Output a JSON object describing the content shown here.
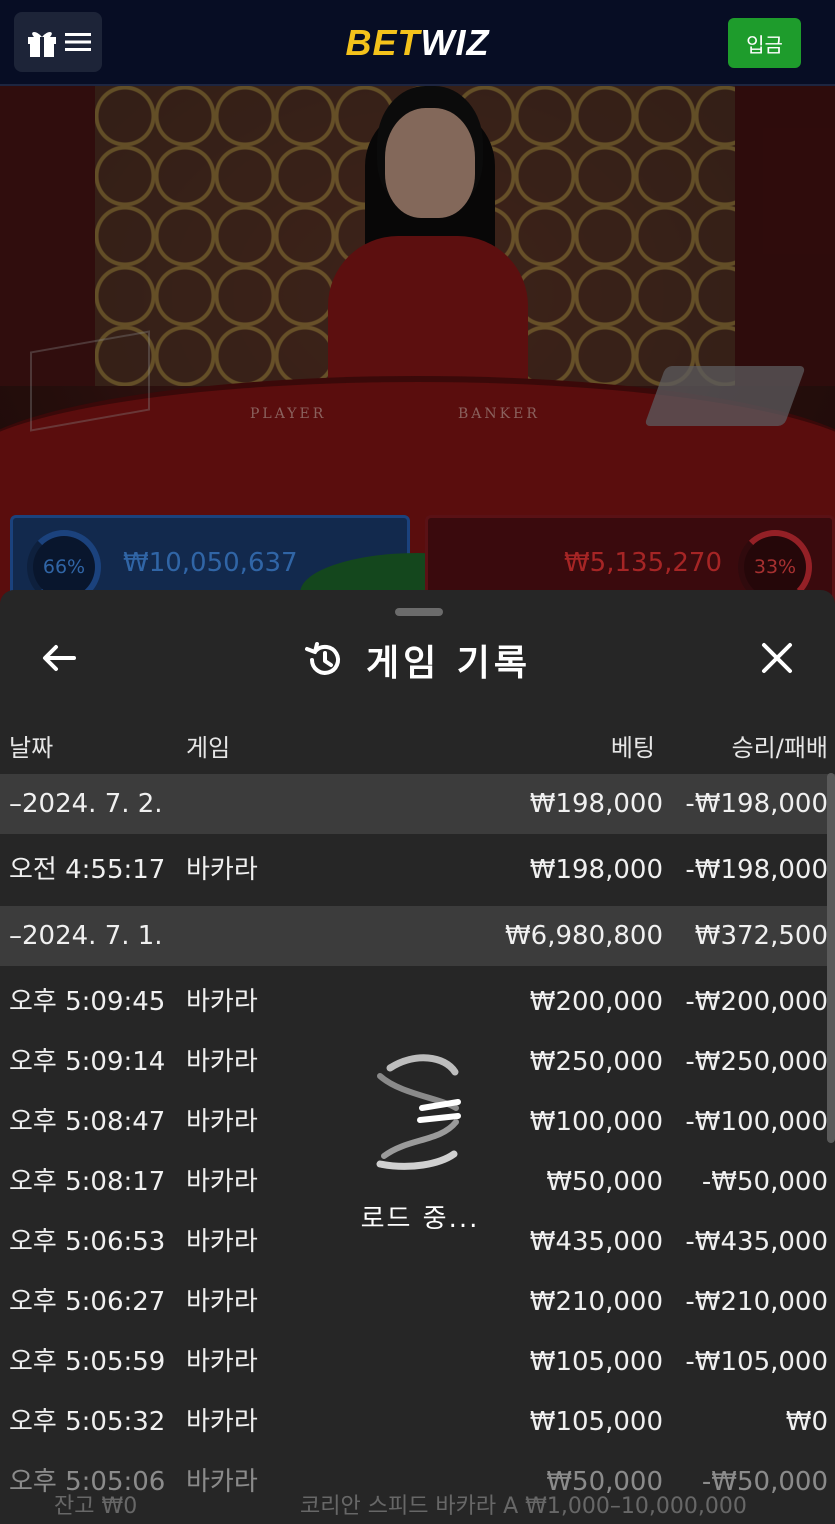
{
  "header": {
    "logo_bet": "BET",
    "logo_wiz": "WIZ",
    "deposit_label": "입금"
  },
  "table": {
    "player_label": "PLAYER",
    "banker_label": "BANKER",
    "player_pct": "66%",
    "player_amount": "₩10,050,637",
    "banker_pct": "33%",
    "banker_amount": "₩5,135,270"
  },
  "modal": {
    "title": "게임 기록",
    "columns": {
      "date": "날짜",
      "game": "게임",
      "bet": "베팅",
      "result": "승리/패배"
    },
    "loading_text": "로드 중..."
  },
  "rows": [
    {
      "type": "date",
      "time": "–2024. 7. 2.",
      "game": "",
      "bet": "₩198,000",
      "result": "-₩198,000"
    },
    {
      "type": "entry",
      "time": "오전 4:55:17",
      "game": "바카라",
      "bet": "₩198,000",
      "result": "-₩198,000"
    },
    {
      "type": "date",
      "time": "–2024. 7. 1.",
      "game": "",
      "bet": "₩6,980,800",
      "result": "₩372,500"
    },
    {
      "type": "entry",
      "time": "오후 5:09:45",
      "game": "바카라",
      "bet": "₩200,000",
      "result": "-₩200,000"
    },
    {
      "type": "entry",
      "time": "오후 5:09:14",
      "game": "바카라",
      "bet": "₩250,000",
      "result": "-₩250,000"
    },
    {
      "type": "entry",
      "time": "오후 5:08:47",
      "game": "바카라",
      "bet": "₩100,000",
      "result": "-₩100,000"
    },
    {
      "type": "entry",
      "time": "오후 5:08:17",
      "game": "바카라",
      "bet": "₩50,000",
      "result": "-₩50,000"
    },
    {
      "type": "entry",
      "time": "오후 5:06:53",
      "game": "바카라",
      "bet": "₩435,000",
      "result": "-₩435,000"
    },
    {
      "type": "entry",
      "time": "오후 5:06:27",
      "game": "바카라",
      "bet": "₩210,000",
      "result": "-₩210,000"
    },
    {
      "type": "entry",
      "time": "오후 5:05:59",
      "game": "바카라",
      "bet": "₩105,000",
      "result": "-₩105,000"
    },
    {
      "type": "entry",
      "time": "오후 5:05:32",
      "game": "바카라",
      "bet": "₩105,000",
      "result": "₩0"
    },
    {
      "type": "entry",
      "time": "오후 5:05:06",
      "game": "바카라",
      "bet": "₩50,000",
      "result": "-₩50,000"
    }
  ],
  "footer": {
    "balance": "잔고 ₩0",
    "table_name": "코리안 스피드 바카라 A ₩1,000–10,000,000"
  },
  "icons": {
    "menu": "gift-menu-icon",
    "back": "arrow-left-icon",
    "history": "history-icon",
    "close": "close-icon",
    "loader": "loading-spinner-icon"
  },
  "colors": {
    "accent_logo": "#f4c21b",
    "deposit": "#1e9c2c",
    "player": "#2a66c0",
    "banker": "#e3323b"
  }
}
